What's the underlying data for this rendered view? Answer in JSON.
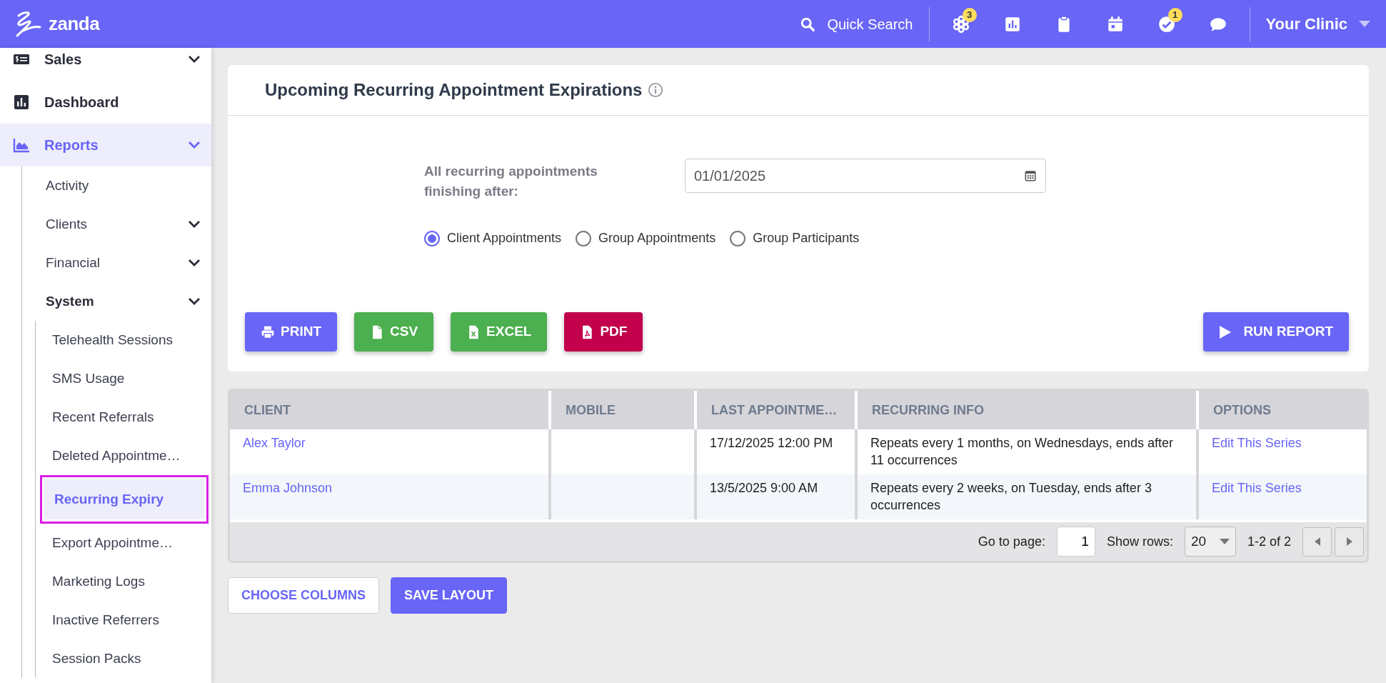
{
  "topbar": {
    "logo": "zanda",
    "search": "Quick Search",
    "icons": [
      {
        "kind": "hex",
        "badge": "3"
      },
      {
        "kind": "chart"
      },
      {
        "kind": "clipboard"
      },
      {
        "kind": "calendar"
      },
      {
        "kind": "check",
        "badge": "1"
      },
      {
        "kind": "chat"
      }
    ],
    "clinic": "Your Clinic"
  },
  "sidebar": {
    "items": [
      {
        "label": "Sales",
        "kind": "sales",
        "expandable": true,
        "selected": false
      },
      {
        "label": "Dashboard",
        "kind": "dashboard",
        "expandable": false,
        "selected": false
      },
      {
        "label": "Reports",
        "kind": "reports",
        "expandable": true,
        "selected": true,
        "children": [
          {
            "label": "Activity",
            "expandable": false,
            "expanded": false,
            "selected": false
          },
          {
            "label": "Clients",
            "expandable": true,
            "expanded": false,
            "selected": false
          },
          {
            "label": "Financial",
            "expandable": true,
            "expanded": false,
            "selected": false
          },
          {
            "label": "System",
            "expandable": true,
            "expanded": true,
            "selected": false,
            "children": [
              {
                "label": "Telehealth Sessions",
                "expandable": false,
                "expanded": false,
                "selected": false
              },
              {
                "label": "SMS Usage",
                "expandable": false,
                "expanded": false,
                "selected": false
              },
              {
                "label": "Recent Referrals",
                "expandable": false,
                "expanded": false,
                "selected": false
              },
              {
                "label": "Deleted Appointme…",
                "expandable": false,
                "expanded": false,
                "selected": false
              },
              {
                "label": "Recurring Expiry",
                "expandable": false,
                "expanded": false,
                "selected": true
              },
              {
                "label": "Export Appointme…",
                "expandable": false,
                "expanded": false,
                "selected": false
              },
              {
                "label": "Marketing Logs",
                "expandable": false,
                "expanded": false,
                "selected": false
              },
              {
                "label": "Inactive Referrers",
                "expandable": false,
                "expanded": false,
                "selected": false
              },
              {
                "label": "Session Packs",
                "expandable": false,
                "expanded": false,
                "selected": false
              }
            ]
          }
        ]
      }
    ]
  },
  "report": {
    "title": "Upcoming Recurring Appointment Expirations",
    "date_label": "All recurring appointments finishing after:",
    "date_value": "01/01/2025",
    "radios": [
      {
        "label": "Client Appointments",
        "selected": true
      },
      {
        "label": "Group Appointments",
        "selected": false
      },
      {
        "label": "Group Participants",
        "selected": false
      }
    ],
    "export_buttons": [
      {
        "label": "PRINT",
        "kind": "print"
      },
      {
        "label": "CSV",
        "kind": "csv"
      },
      {
        "label": "EXCEL",
        "kind": "excel"
      },
      {
        "label": "PDF",
        "kind": "pdf"
      }
    ],
    "run_button": "RUN REPORT"
  },
  "table": {
    "columns": [
      "CLIENT",
      "MOBILE",
      "LAST APPOINTME…",
      "RECURRING INFO",
      "OPTIONS"
    ],
    "rows": [
      {
        "cells": [
          "Alex Taylor",
          null,
          "17/12/2025 12:00 PM",
          "Repeats every 1 months, on Wednesdays, ends after 11 occurrences",
          "Edit This Series"
        ]
      },
      {
        "cells": [
          "Emma Johnson",
          null,
          "13/5/2025 9:00 AM",
          "Repeats every 2 weeks, on Tuesday, ends after 3 occurrences",
          "Edit This Series"
        ]
      }
    ],
    "pager": {
      "goto_label": "Go to page:",
      "page": "1",
      "rows_label": "Show rows:",
      "rows_value": "20",
      "range": "1-2 of 2"
    }
  },
  "bottom_buttons": [
    {
      "label": "CHOOSE COLUMNS",
      "kind": "outline"
    },
    {
      "label": "SAVE LAYOUT",
      "kind": "solid"
    }
  ]
}
